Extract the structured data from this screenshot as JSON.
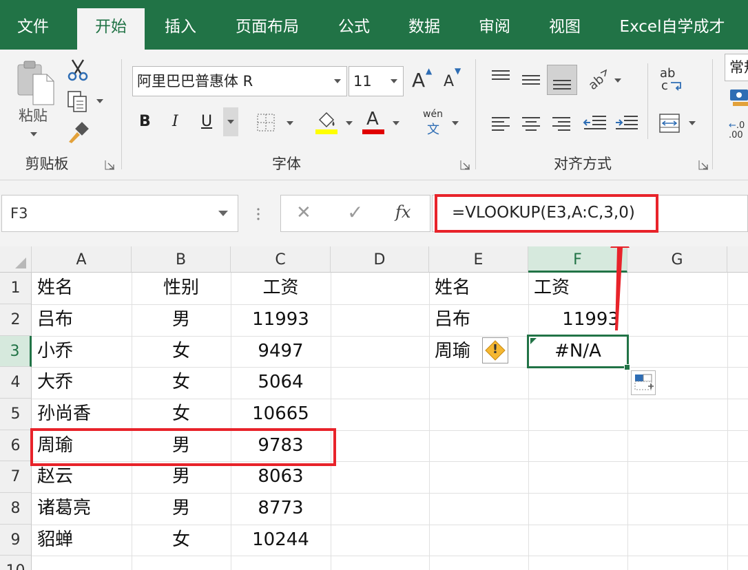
{
  "tabs": [
    "文件",
    "开始",
    "插入",
    "页面布局",
    "公式",
    "数据",
    "审阅",
    "视图",
    "Excel自学成才"
  ],
  "active_tab": "开始",
  "ribbon": {
    "clipboard": {
      "paste_label": "粘贴",
      "group_label": "剪贴板"
    },
    "font": {
      "font_name": "阿里巴巴普惠体 R",
      "font_size": "11",
      "grow_glyph": "A",
      "shrink_glyph": "A",
      "bold": "B",
      "italic": "I",
      "underline": "U",
      "font_color_glyph": "A",
      "phonetic_top": "wén",
      "phonetic_bottom": "文",
      "group_label": "字体",
      "fill_color": "#ffff00",
      "font_color": "#e00000"
    },
    "alignment": {
      "group_label": "对齐方式",
      "wrap_top": "ab",
      "wrap_bottom": "c"
    },
    "number": {
      "format_partial": "常规",
      "dec_partial": ".0",
      "dec_partial2": ".00"
    }
  },
  "formula_bar": {
    "name_box": "F3",
    "cancel_glyph": "✕",
    "enter_glyph": "✓",
    "fx_label": "fx",
    "formula": "=VLOOKUP(E3,A:C,3,0)"
  },
  "sheet": {
    "columns": [
      "A",
      "B",
      "C",
      "D",
      "E",
      "F",
      "G"
    ],
    "selected_column": "F",
    "rows": [
      "1",
      "2",
      "3",
      "4",
      "5",
      "6",
      "7",
      "8",
      "9",
      "10"
    ],
    "selected_row": "3",
    "table_header": [
      "姓名",
      "性别",
      "工资"
    ],
    "table": [
      [
        "吕布",
        "男",
        "11993"
      ],
      [
        "小乔",
        "女",
        "9497"
      ],
      [
        "大乔",
        "女",
        "5064"
      ],
      [
        "孙尚香",
        "女",
        "10665"
      ],
      [
        "周瑜",
        "男",
        "9783"
      ],
      [
        "赵云",
        "男",
        "8063"
      ],
      [
        "诸葛亮",
        "男",
        "8773"
      ],
      [
        "貂蝉",
        "女",
        "10244"
      ]
    ],
    "lookup_header": [
      "姓名",
      "工资"
    ],
    "lookup_rows": [
      [
        "吕布",
        "11993"
      ],
      [
        "周瑜",
        "#N/A"
      ]
    ],
    "error_icon": "!"
  },
  "colors": {
    "excel_green": "#217346",
    "highlight_red": "#e8232a"
  }
}
